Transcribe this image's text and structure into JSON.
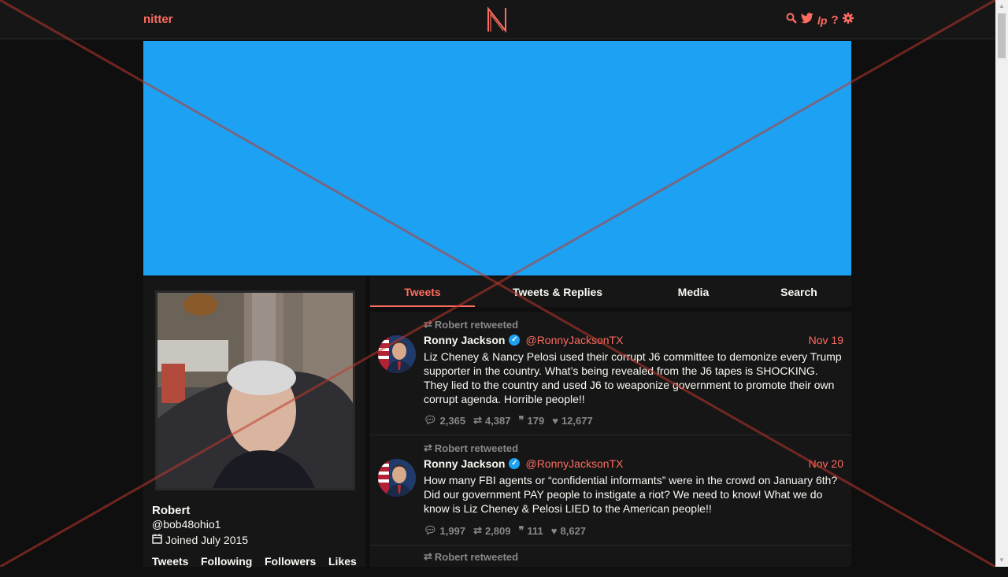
{
  "nav": {
    "brand": "nitter",
    "icons": [
      "search-icon",
      "twitter-icon",
      "liberapay-icon",
      "help-icon",
      "settings-icon"
    ]
  },
  "colors": {
    "accent": "#ff6c60",
    "banner": "#1da1f2",
    "background": "#0f0f0f",
    "panel": "#161616",
    "muted": "#888888"
  },
  "profile": {
    "fullname": "Robert",
    "username": "@bob48ohio1",
    "joined": "Joined July 2015",
    "stats": [
      "Tweets",
      "Following",
      "Followers",
      "Likes"
    ]
  },
  "tabs": [
    {
      "label": "Tweets",
      "active": true
    },
    {
      "label": "Tweets & Replies",
      "active": false
    },
    {
      "label": "Media",
      "active": false
    },
    {
      "label": "Search",
      "active": false
    }
  ],
  "tweets": [
    {
      "retweet_label": "Robert retweeted",
      "name": "Ronny Jackson",
      "handle": "@RonnyJacksonTX",
      "date": "Nov 19",
      "text": "Liz Cheney & Nancy Pelosi used their corrupt J6 committee to demonize every Trump supporter in the country. What’s being revealed from the J6 tapes is SHOCKING. They lied to the country and used J6 to weaponize government to promote their own corrupt agenda. Horrible people!!",
      "replies": "2,365",
      "retweets": "4,387",
      "quotes": "179",
      "likes": "12,677"
    },
    {
      "retweet_label": "Robert retweeted",
      "name": "Ronny Jackson",
      "handle": "@RonnyJacksonTX",
      "date": "Nov 20",
      "text": "How many FBI agents or “confidential informants” were in the crowd on January 6th? Did our government PAY people to instigate a riot? We need to know! What we do know is Liz Cheney & Pelosi LIED to the American people!!",
      "replies": "1,997",
      "retweets": "2,809",
      "quotes": "111",
      "likes": "8,627"
    },
    {
      "retweet_label": "Robert retweeted"
    }
  ]
}
